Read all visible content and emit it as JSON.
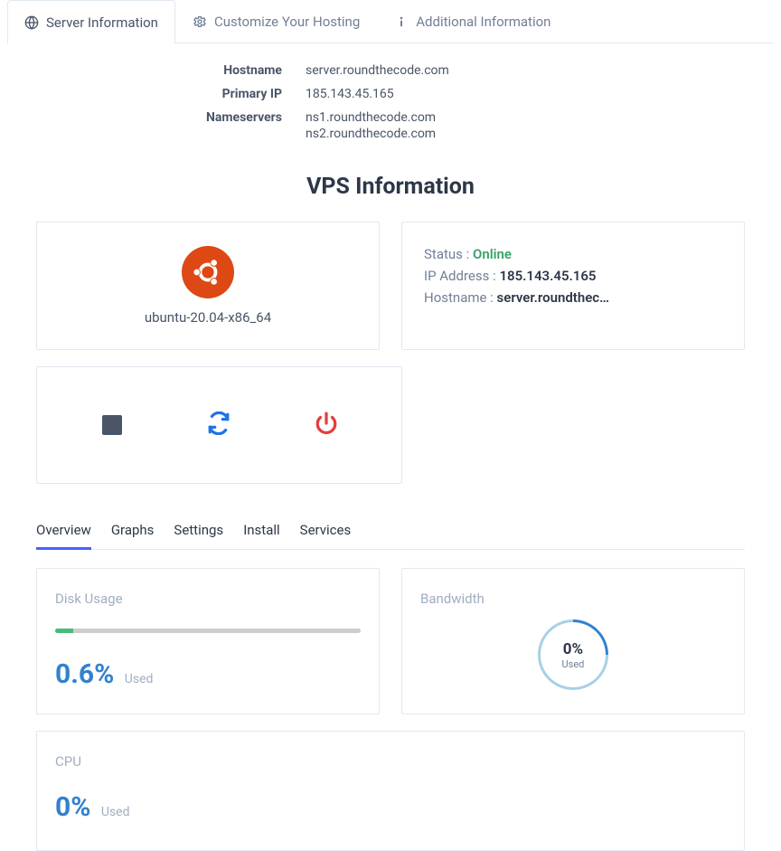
{
  "tabs": {
    "server_info": "Server Information",
    "customize": "Customize Your Hosting",
    "additional": "Additional Information"
  },
  "server": {
    "hostname_label": "Hostname",
    "hostname_value": "server.roundthecode.com",
    "primary_ip_label": "Primary IP",
    "primary_ip_value": "185.143.45.165",
    "nameservers_label": "Nameservers",
    "nameserver1": "ns1.roundthecode.com",
    "nameserver2": "ns2.roundthecode.com"
  },
  "vps_title": "VPS Information",
  "os": {
    "name": "ubuntu-20.04-x86_64"
  },
  "status": {
    "status_label": "Status :",
    "status_value": "Online",
    "ip_label": "IP Address :",
    "ip_value": "185.143.45.165",
    "hostname_label": "Hostname :",
    "hostname_value": "server.roundthec…"
  },
  "sub_tabs": {
    "overview": "Overview",
    "graphs": "Graphs",
    "settings": "Settings",
    "install": "Install",
    "services": "Services"
  },
  "disk": {
    "title": "Disk Usage",
    "pct": "0.6%",
    "used": "Used",
    "fill_pct": 0.6
  },
  "bandwidth": {
    "title": "Bandwidth",
    "pct": "0%",
    "used": "Used"
  },
  "cpu": {
    "title": "CPU",
    "pct": "0%",
    "used": "Used"
  }
}
